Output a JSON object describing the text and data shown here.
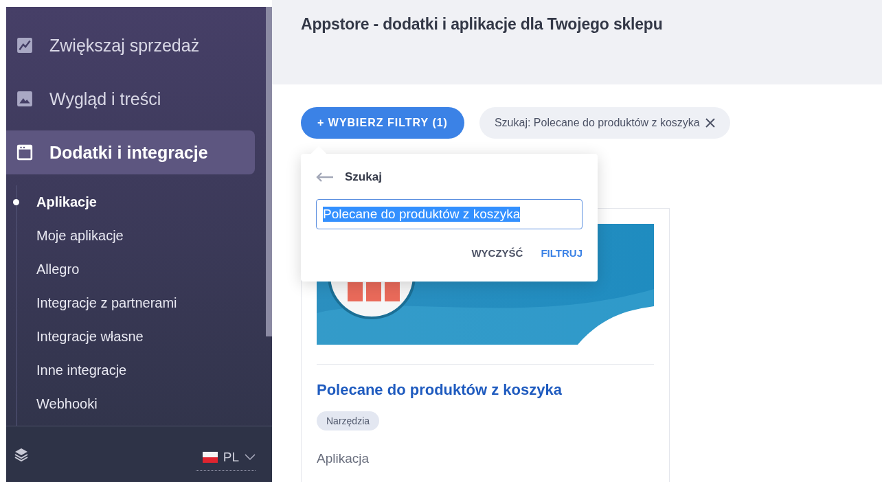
{
  "sidebar": {
    "sections": [
      {
        "label": "Zwiększaj sprzedaż",
        "kind": "chart",
        "selected": false
      },
      {
        "label": "Wygląd i treści",
        "kind": "image",
        "selected": false
      },
      {
        "label": "Dodatki i integracje",
        "kind": "window",
        "selected": true
      }
    ],
    "subitems": [
      {
        "label": "Aplikacje",
        "selected": true
      },
      {
        "label": "Moje aplikacje",
        "selected": false
      },
      {
        "label": "Allegro",
        "selected": false
      },
      {
        "label": "Integracje z partnerami",
        "selected": false
      },
      {
        "label": "Integracje własne",
        "selected": false
      },
      {
        "label": "Inne integracje",
        "selected": false
      },
      {
        "label": "Webhooki",
        "selected": false
      }
    ],
    "footer": {
      "language": "PL"
    }
  },
  "header": {
    "title": "Appstore - dodatki i aplikacje dla Twojego sklepu"
  },
  "filters": {
    "button": "+ WYBIERZ FILTRY (1)",
    "active_filter": "Szukaj: Polecane do produktów z koszyka",
    "popover": {
      "title": "Szukaj",
      "value": "Polecane do produktów z koszyka",
      "value_selected": true,
      "actions": [
        {
          "label": "WYCZYŚĆ",
          "kind": "secondary"
        },
        {
          "label": "FILTRUJ",
          "kind": "primary"
        }
      ]
    }
  },
  "card": {
    "title": "Polecane do produktów z koszyka",
    "tag": "Narzędzia",
    "type": "Aplikacja"
  }
}
